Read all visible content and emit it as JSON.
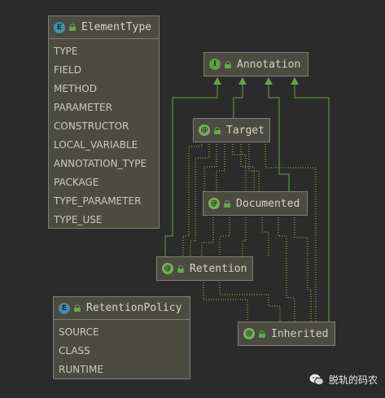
{
  "colors": {
    "background": "#2b2b2b",
    "node_fill": "#4c4b3f",
    "node_border": "#7f7f7a",
    "edge": "#6aa14a",
    "enum_badge": "#3f8fb2",
    "interface_badge": "#5f9e45",
    "annotation_badge": "#7bb05e"
  },
  "nodes": {
    "element_type": {
      "badge": "E",
      "title": "ElementType",
      "items": [
        "TYPE",
        "FIELD",
        "METHOD",
        "PARAMETER",
        "CONSTRUCTOR",
        "LOCAL_VARIABLE",
        "ANNOTATION_TYPE",
        "PACKAGE",
        "TYPE_PARAMETER",
        "TYPE_USE"
      ]
    },
    "annotation": {
      "badge": "I",
      "title": "Annotation"
    },
    "target": {
      "badge": "@",
      "title": "Target"
    },
    "documented": {
      "badge": "@",
      "title": "Documented"
    },
    "retention": {
      "badge": "@",
      "title": "Retention"
    },
    "retention_policy": {
      "badge": "E",
      "title": "RetentionPolicy",
      "items": [
        "SOURCE",
        "CLASS",
        "RUNTIME"
      ]
    },
    "inherited": {
      "badge": "@",
      "title": "Inherited"
    }
  },
  "watermark": {
    "icon": "wechat-icon",
    "text": "脱轨的码农"
  }
}
